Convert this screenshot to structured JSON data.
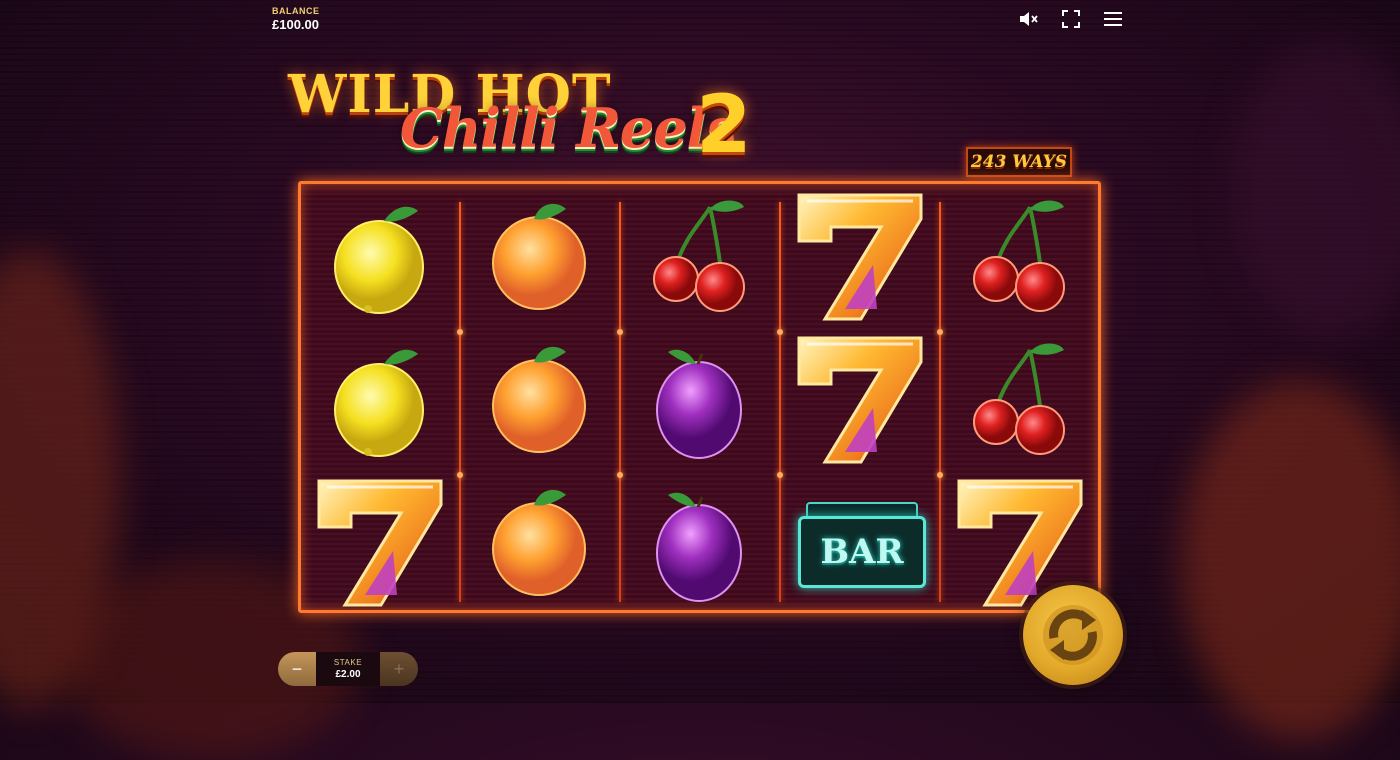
{
  "balance": {
    "label": "BALANCE",
    "value": "£100.00"
  },
  "top_icons": [
    "mute-icon",
    "fullscreen-icon",
    "menu-icon"
  ],
  "logo": {
    "line1": "WILD HOT",
    "line2": "Chilli Reels",
    "number": "2",
    "lettering_as_picture": true
  },
  "ways_badge": "243 WAYS",
  "reels": [
    [
      "lemon",
      "lemon",
      "seven"
    ],
    [
      "orange",
      "orange",
      "orange"
    ],
    [
      "cherry",
      "plum",
      "plum"
    ],
    [
      "seven",
      "seven",
      "bar"
    ],
    [
      "cherry",
      "cherry",
      "seven"
    ]
  ],
  "bar_symbol_text": "BAR",
  "stake": {
    "label": "STAKE",
    "value": "£2.00",
    "minus_label": "−",
    "plus_label": "+"
  },
  "colors": {
    "frame": "#ff7a2a",
    "gold": "#ffd23a",
    "spin_button": "#e2a82a"
  }
}
